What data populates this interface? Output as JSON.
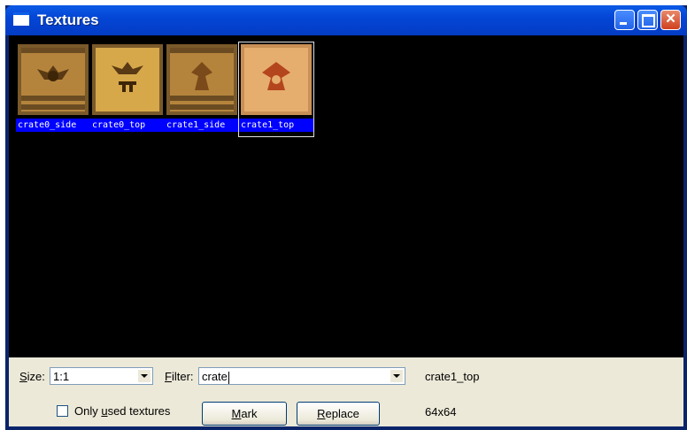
{
  "window": {
    "title": "Textures",
    "title_icon": "window-icon"
  },
  "textures": [
    {
      "name": "crate0_side",
      "selected": false
    },
    {
      "name": "crate0_top",
      "selected": false
    },
    {
      "name": "crate1_side",
      "selected": false
    },
    {
      "name": "crate1_top",
      "selected": true
    }
  ],
  "toolbar": {
    "size_label_u": "S",
    "size_label_rest": "ize:",
    "size_value": "1:1",
    "filter_label_u": "F",
    "filter_label_rest": "ilter:",
    "filter_value": "crate",
    "selected_name": "crate1_top",
    "only_used_pre": "Only ",
    "only_used_u": "u",
    "only_used_post": "sed textures",
    "only_used_checked": false,
    "mark_u": "M",
    "mark_rest": "ark",
    "replace_u": "R",
    "replace_rest": "eplace",
    "dimensions": "64x64"
  },
  "colors": {
    "label_bg": "#0000ff",
    "client_bg": "#000000",
    "titlebar": "#0446d6"
  }
}
